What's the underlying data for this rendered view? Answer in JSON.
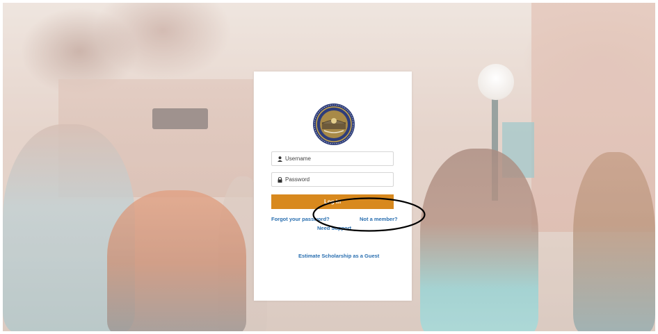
{
  "login": {
    "username_placeholder": "Username",
    "password_placeholder": "Password",
    "login_label": "Log In",
    "forgot_password": "Forgot your password?",
    "not_member": "Not a member?",
    "need_support": "Need Support",
    "guest_estimate": "Estimate Scholarship as a Guest"
  },
  "icons": {
    "username": "user-icon",
    "password": "lock-icon",
    "seal": "state-seal-icon"
  },
  "colors": {
    "login_button": "#d8891e",
    "link": "#2a6fb0",
    "annotation": "#000000"
  }
}
